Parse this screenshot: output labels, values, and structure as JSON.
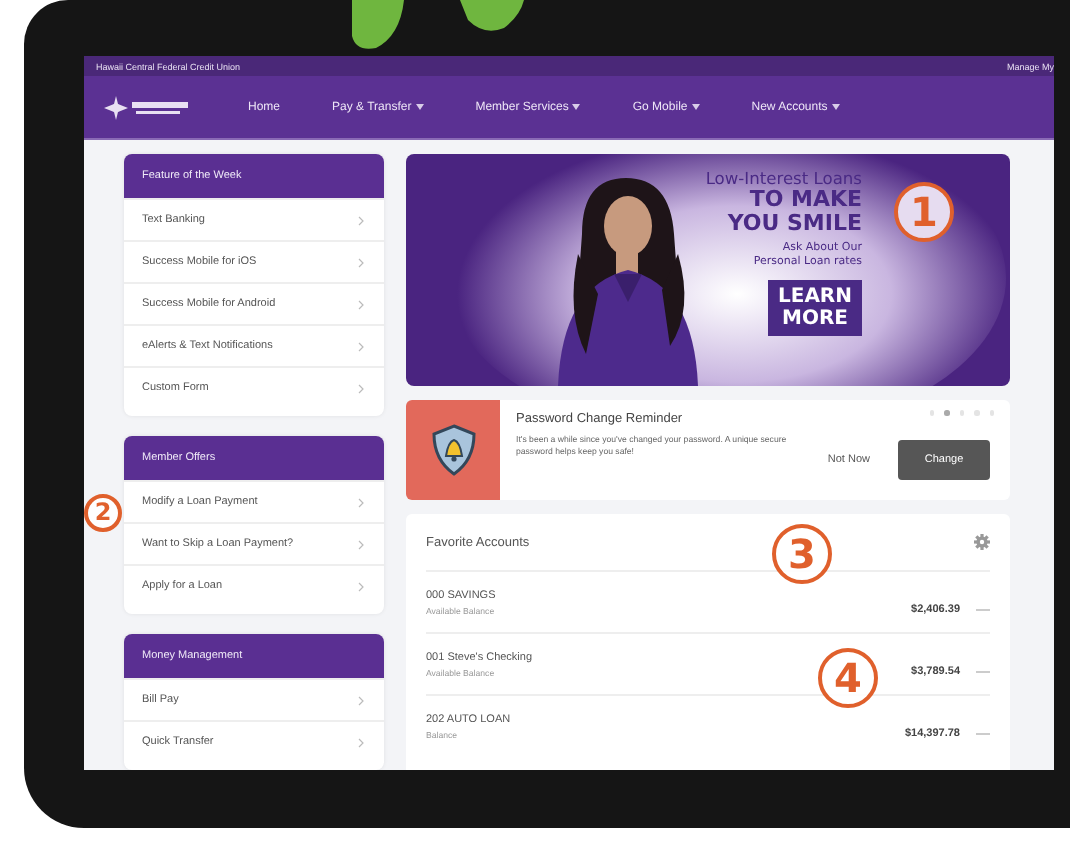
{
  "top_bar": {
    "title": "Hawaii Central Federal Credit Union",
    "link": "Manage My"
  },
  "nav": {
    "items": [
      {
        "label": "Home",
        "dropdown": false
      },
      {
        "label": "Pay & Transfer",
        "dropdown": true
      },
      {
        "label": "Member Services",
        "dropdown": true
      },
      {
        "label": "Go Mobile",
        "dropdown": true
      },
      {
        "label": "New Accounts",
        "dropdown": true
      }
    ]
  },
  "sidebar": [
    {
      "title": "Feature of the Week",
      "items": [
        "Text Banking",
        "Success Mobile for iOS",
        "Success Mobile for Android",
        "eAlerts & Text Notifications",
        "Custom Form"
      ]
    },
    {
      "title": "Member Offers",
      "callout": "2",
      "items": [
        "Modify a Loan Payment",
        "Want to Skip a Loan Payment?",
        "Apply for a Loan"
      ]
    },
    {
      "title": "Money Management",
      "items": [
        "Bill Pay",
        "Quick Transfer"
      ]
    }
  ],
  "banner": {
    "kind": "picture",
    "callout": "1",
    "headline": "Low-Interest Loans",
    "title_lines": [
      "TO MAKE",
      "YOU SMILE"
    ],
    "subtitle_lines": [
      "Ask About Our",
      "Personal Loan rates"
    ],
    "button_lines": [
      "LEARN",
      "MORE"
    ]
  },
  "reminder": {
    "title": "Password Change Reminder",
    "message": "It's been a while since you've changed your password. A unique secure password helps keep you safe!",
    "dismiss": "Not Now",
    "action": "Change",
    "dots": [
      {
        "selected": false
      },
      {
        "selected": true
      },
      {
        "selected": false
      },
      {
        "selected": false
      },
      {
        "selected": false
      }
    ]
  },
  "favorite_accounts": {
    "title": "Favorite Accounts",
    "callout": "3",
    "accounts": [
      {
        "name": "000 SAVINGS",
        "balance_label": "Available Balance",
        "balance": "$2,406.39"
      },
      {
        "name": "001 Steve's Checking",
        "balance_label": "Available Balance",
        "balance": "$3,789.54",
        "callout": "4"
      },
      {
        "name": "202 AUTO LOAN",
        "balance_label": "Balance",
        "balance": "$14,397.78"
      }
    ]
  }
}
